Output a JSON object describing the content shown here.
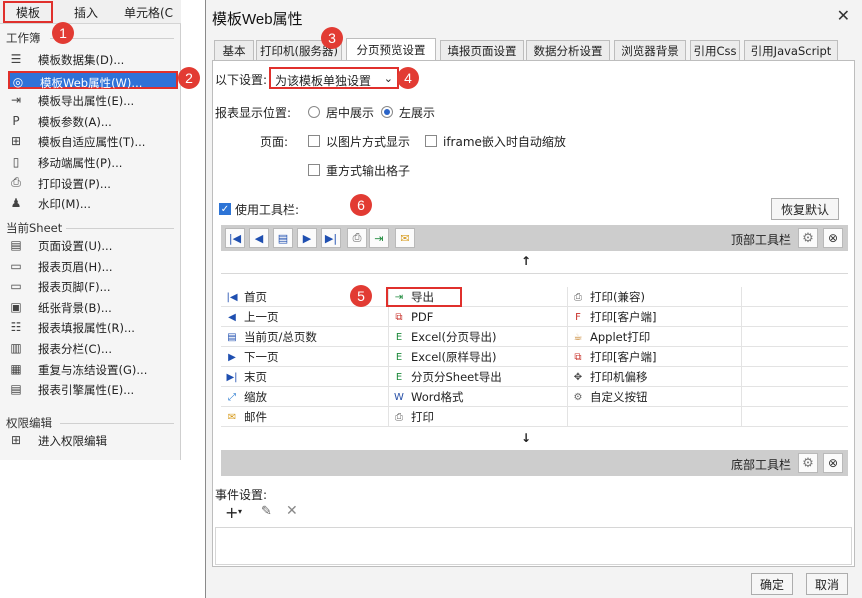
{
  "menu": {
    "tabs": [
      "模板",
      "插入",
      "单元格(C"
    ],
    "section_workbook": "工作簿",
    "workbook_items": [
      {
        "icon": "database-icon",
        "label": "模板数据集(D)..."
      },
      {
        "icon": "globe-icon",
        "label": "模板Web属性(W)..."
      },
      {
        "icon": "export-icon",
        "label": "模板导出属性(E)..."
      },
      {
        "icon": "param-icon",
        "label": "模板参数(A)..."
      },
      {
        "icon": "adaptive-icon",
        "label": "模板自适应属性(T)..."
      },
      {
        "icon": "mobile-icon",
        "label": "移动端属性(P)..."
      },
      {
        "icon": "printer-icon",
        "label": "打印设置(P)..."
      },
      {
        "icon": "stamp-icon",
        "label": "水印(M)..."
      }
    ],
    "section_sheet": "当前Sheet",
    "sheet_items": [
      {
        "icon": "page-setup-icon",
        "label": "页面设置(U)..."
      },
      {
        "icon": "header-icon",
        "label": "报表页眉(H)..."
      },
      {
        "icon": "footer-icon",
        "label": "报表页脚(F)..."
      },
      {
        "icon": "image-icon",
        "label": "纸张背景(B)..."
      },
      {
        "icon": "fill-icon",
        "label": "报表填报属性(R)..."
      },
      {
        "icon": "pagebreak-icon",
        "label": "报表分栏(C)..."
      },
      {
        "icon": "freeze-icon",
        "label": "重复与冻结设置(G)..."
      },
      {
        "icon": "engine-icon",
        "label": "报表引擎属性(E)..."
      }
    ],
    "section_perm": "权限编辑",
    "perm_items": [
      {
        "icon": "permission-icon",
        "label": "进入权限编辑"
      }
    ]
  },
  "dialog": {
    "title": "模板Web属性",
    "close": "✕",
    "tabs": [
      "基本",
      "打印机(服务器)",
      "分页预览设置",
      "填报页面设置",
      "数据分析设置",
      "浏览器背景",
      "引用Css",
      "引用JavaScript"
    ],
    "active_tab": 2,
    "settings_label": "以下设置:",
    "settings_value": "为该模板单独设置",
    "display_pos_label": "报表显示位置:",
    "center_label": "居中展示",
    "left_label": "左展示",
    "page_label": "页面:",
    "image_mode_label": "以图片方式显示",
    "iframe_label": "iframe嵌入时自动缩放",
    "repeat_label": "重方式输出格子",
    "use_toolbar_label": "使用工具栏:",
    "restore_label": "恢复默认",
    "top_toolbar_label": "顶部工具栏",
    "bottom_toolbar_label": "底部工具栏",
    "up_arrow": "↑",
    "down_arrow": "↓",
    "grid_col1": [
      {
        "icon": "first-page-icon",
        "label": "首页"
      },
      {
        "icon": "prev-page-icon",
        "label": "上一页"
      },
      {
        "icon": "page-count-icon",
        "label": "当前页/总页数"
      },
      {
        "icon": "next-page-icon",
        "label": "下一页"
      },
      {
        "icon": "last-page-icon",
        "label": "末页"
      },
      {
        "icon": "zoom-icon",
        "label": "缩放"
      },
      {
        "icon": "mail-icon",
        "label": "邮件"
      }
    ],
    "grid_col2": [
      {
        "icon": "export-icon",
        "label": "导出"
      },
      {
        "icon": "pdf-icon",
        "label": "PDF"
      },
      {
        "icon": "excel-icon",
        "label": "Excel(分页导出)"
      },
      {
        "icon": "excel-icon",
        "label": "Excel(原样导出)"
      },
      {
        "icon": "excel-icon",
        "label": "分页分Sheet导出"
      },
      {
        "icon": "word-icon",
        "label": "Word格式"
      },
      {
        "icon": "printer-icon",
        "label": "打印"
      }
    ],
    "grid_col3": [
      {
        "icon": "printer-icon",
        "label": "打印(兼容)"
      },
      {
        "icon": "flash-icon",
        "label": "打印[客户端]"
      },
      {
        "icon": "applet-icon",
        "label": "Applet打印"
      },
      {
        "icon": "pdf-icon",
        "label": "打印[客户端]"
      },
      {
        "icon": "move-icon",
        "label": "打印机偏移"
      },
      {
        "icon": "gear-icon",
        "label": "自定义按钮"
      }
    ],
    "events_label": "事件设置:",
    "ok_label": "确定",
    "cancel_label": "取消"
  },
  "badges": [
    "1",
    "2",
    "3",
    "4",
    "5",
    "6"
  ],
  "colors": {
    "badge": "#e23b33",
    "highlight": "#e0302c",
    "selection": "#2f72d8"
  }
}
